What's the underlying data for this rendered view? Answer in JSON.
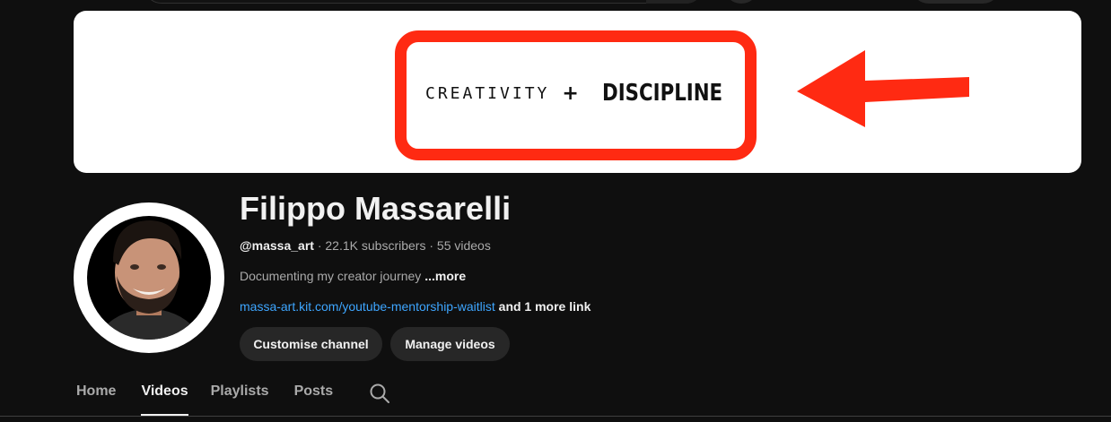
{
  "banner": {
    "word1": "CREATIVITY",
    "plus": "+",
    "word2": "DISCIPLINE",
    "frame_color": "#ff2a12",
    "arrow_color": "#ff2a12"
  },
  "channel": {
    "name": "Filippo Massarelli",
    "handle": "@massa_art",
    "separator": " · ",
    "subscribers": "22.1K subscribers",
    "videos": "55 videos",
    "description": "Documenting my creator journey ",
    "more": "...more",
    "link": "massa-art.kit.com/youtube-mentorship-waitlist",
    "more_links": " and 1 more link"
  },
  "buttons": {
    "customise": "Customise channel",
    "manage": "Manage videos"
  },
  "tabs": [
    {
      "label": "Home",
      "active": false
    },
    {
      "label": "Videos",
      "active": true
    },
    {
      "label": "Playlists",
      "active": false
    },
    {
      "label": "Posts",
      "active": false
    }
  ],
  "icons": {
    "tab_search": "search-icon"
  },
  "colors": {
    "background": "#0f0f0f",
    "link": "#3ea6ff",
    "button_bg": "#272727"
  }
}
